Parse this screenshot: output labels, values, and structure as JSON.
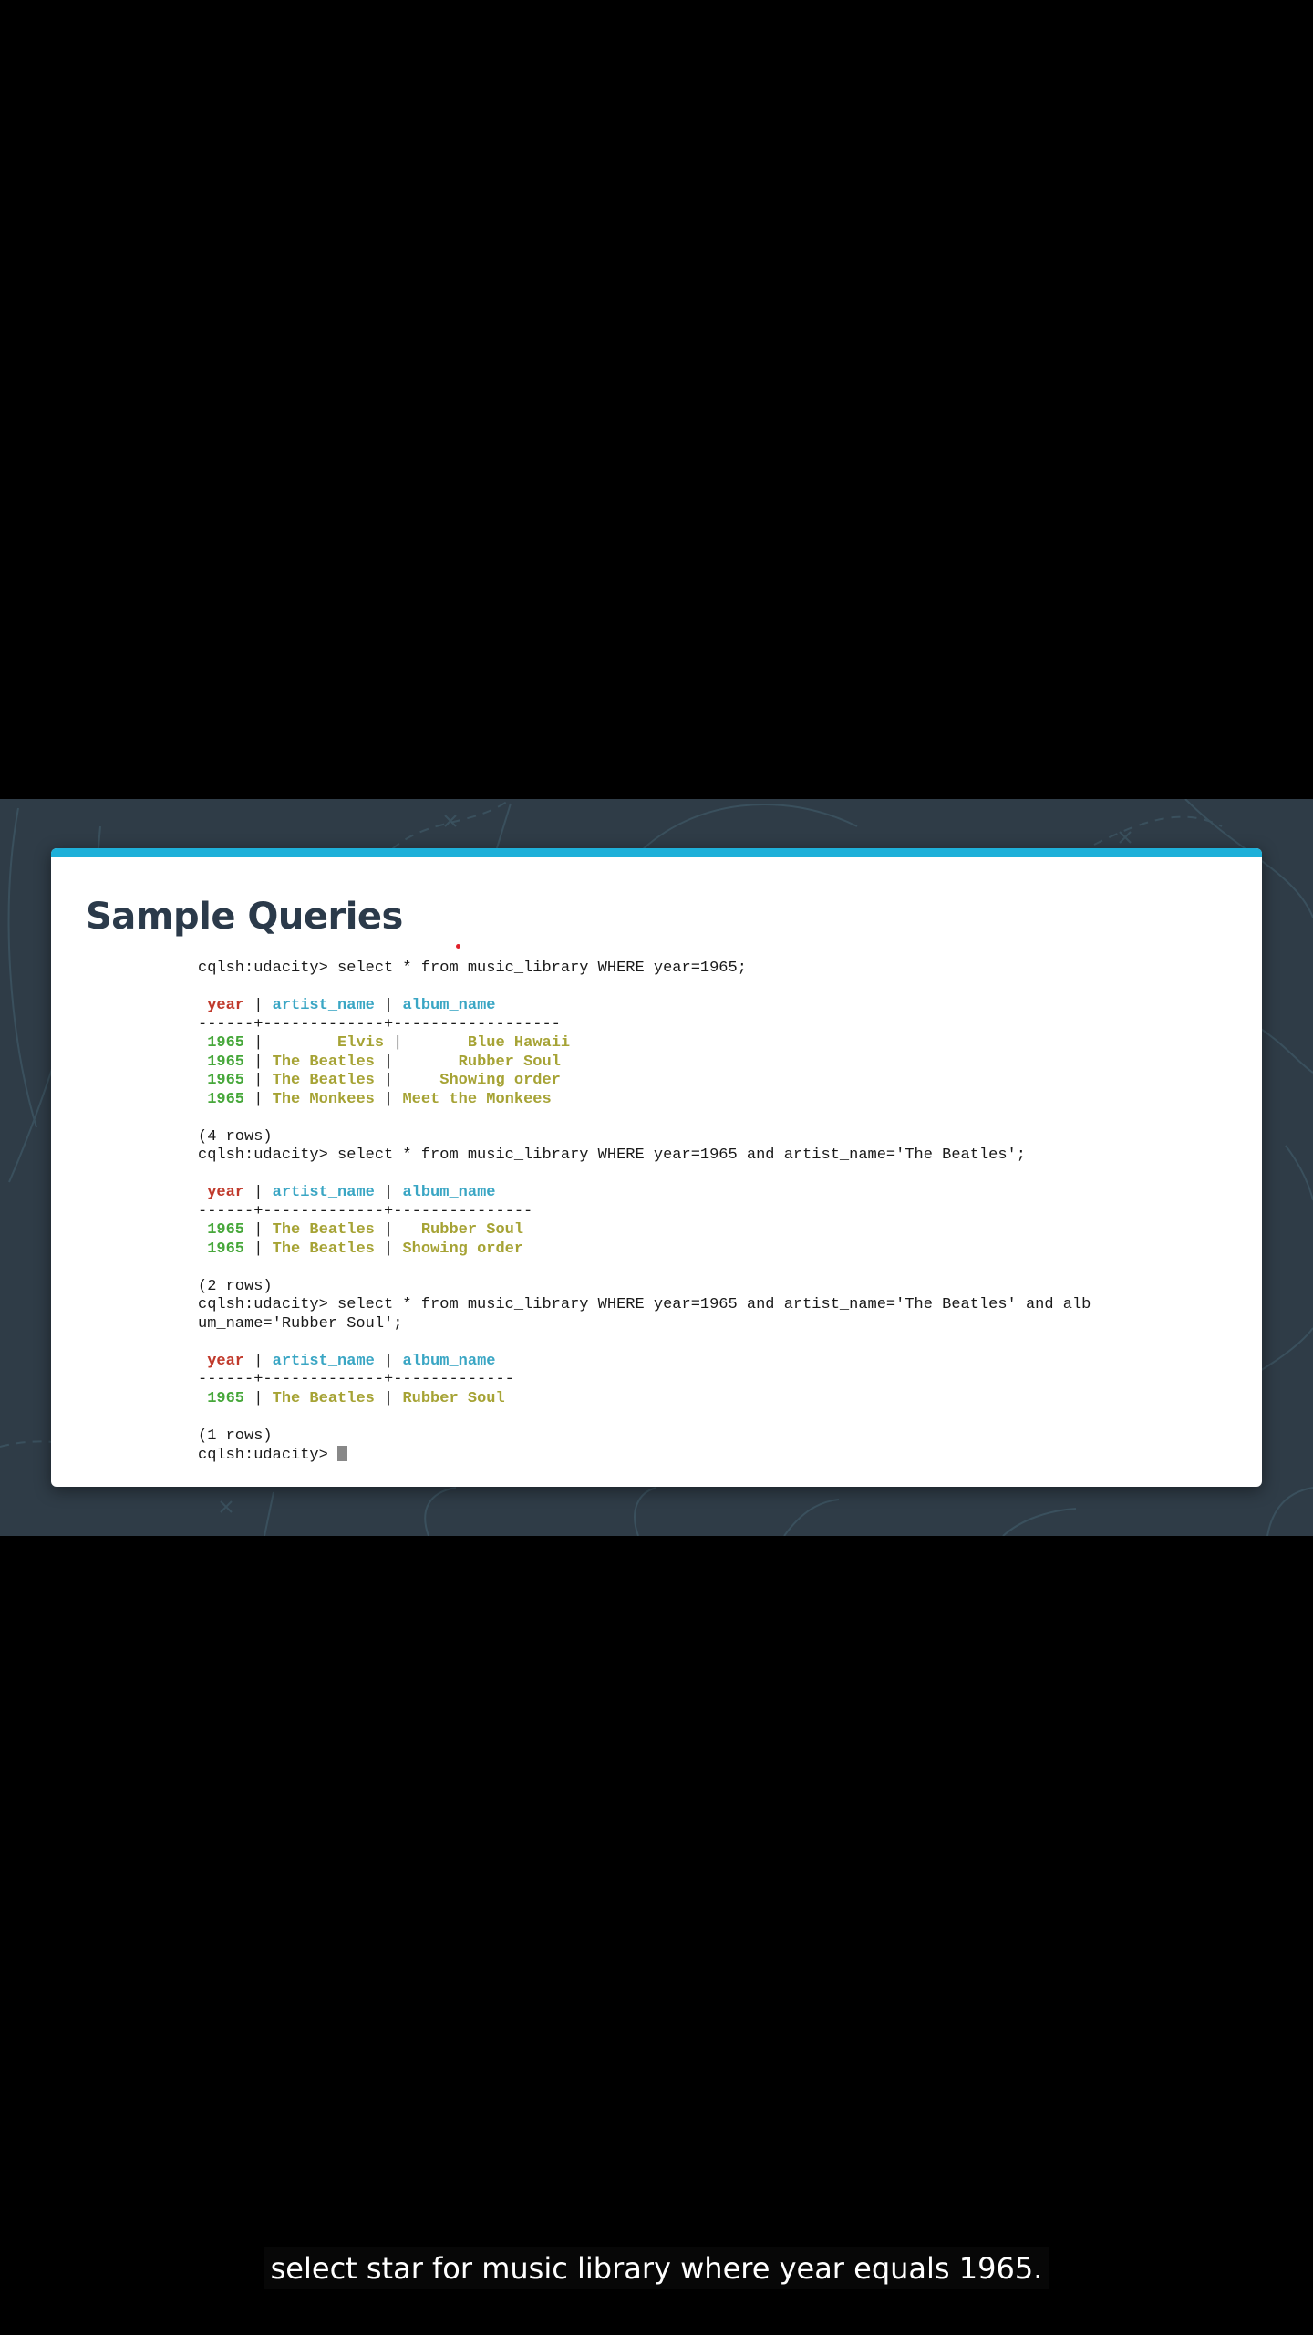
{
  "slide": {
    "title": "Sample Queries",
    "accent_color": "#1eb0d9",
    "background_color": "#2f3c47"
  },
  "terminal": {
    "lines": [
      {
        "type": "cmd",
        "text": "cqlsh:udacity> select * from music_library WHERE year=1965;"
      },
      {
        "type": "blank"
      },
      {
        "type": "header",
        "cells": [
          "year",
          "artist_name",
          "album_name"
        ],
        "pads": [
          " ",
          " | ",
          " | "
        ]
      },
      {
        "type": "sep",
        "text": "------+-------------+------------------"
      },
      {
        "type": "row",
        "cells": [
          "1965",
          "Elvis",
          "Blue Hawaii"
        ],
        "raw": [
          " ",
          "1965",
          " |        ",
          "Elvis",
          " |       ",
          "Blue Hawaii"
        ]
      },
      {
        "type": "row",
        "cells": [
          "1965",
          "The Beatles",
          "Rubber Soul"
        ],
        "raw": [
          " ",
          "1965",
          " | ",
          "The Beatles",
          " |       ",
          "Rubber Soul"
        ]
      },
      {
        "type": "row",
        "cells": [
          "1965",
          "The Beatles",
          "Showing order"
        ],
        "raw": [
          " ",
          "1965",
          " | ",
          "The Beatles",
          " |     ",
          "Showing order"
        ]
      },
      {
        "type": "row",
        "cells": [
          "1965",
          "The Monkees",
          "Meet the Monkees"
        ],
        "raw": [
          " ",
          "1965",
          " | ",
          "The Monkees",
          " | ",
          "Meet the Monkees"
        ]
      },
      {
        "type": "blank"
      },
      {
        "type": "plain",
        "text": "(4 rows)"
      },
      {
        "type": "cmd",
        "text": "cqlsh:udacity> select * from music_library WHERE year=1965 and artist_name='The Beatles';"
      },
      {
        "type": "blank"
      },
      {
        "type": "header",
        "cells": [
          "year",
          "artist_name",
          "album_name"
        ],
        "pads": [
          " ",
          " | ",
          " | "
        ]
      },
      {
        "type": "sep",
        "text": "------+-------------+---------------"
      },
      {
        "type": "row",
        "cells": [
          "1965",
          "The Beatles",
          "Rubber Soul"
        ],
        "raw": [
          " ",
          "1965",
          " | ",
          "The Beatles",
          " |   ",
          "Rubber Soul"
        ]
      },
      {
        "type": "row",
        "cells": [
          "1965",
          "The Beatles",
          "Showing order"
        ],
        "raw": [
          " ",
          "1965",
          " | ",
          "The Beatles",
          " | ",
          "Showing order"
        ]
      },
      {
        "type": "blank"
      },
      {
        "type": "plain",
        "text": "(2 rows)"
      },
      {
        "type": "cmd",
        "text": "cqlsh:udacity> select * from music_library WHERE year=1965 and artist_name='The Beatles' and alb"
      },
      {
        "type": "plain",
        "text": "um_name='Rubber Soul';"
      },
      {
        "type": "blank"
      },
      {
        "type": "header",
        "cells": [
          "year",
          "artist_name",
          "album_name"
        ],
        "pads": [
          " ",
          " | ",
          " | "
        ]
      },
      {
        "type": "sep",
        "text": "------+-------------+-------------"
      },
      {
        "type": "row",
        "cells": [
          "1965",
          "The Beatles",
          "Rubber Soul"
        ],
        "raw": [
          " ",
          "1965",
          " | ",
          "The Beatles",
          " | ",
          "Rubber Soul"
        ]
      },
      {
        "type": "blank"
      },
      {
        "type": "plain",
        "text": "(1 rows)"
      },
      {
        "type": "prompt",
        "text": "cqlsh:udacity> "
      }
    ]
  },
  "caption": {
    "text": "select star for music library where year equals 1965."
  }
}
